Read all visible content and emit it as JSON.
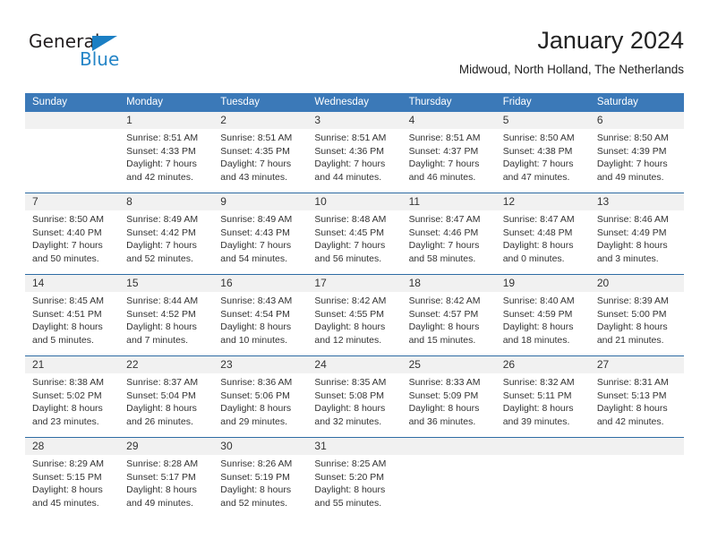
{
  "brand": {
    "name_part1": "General",
    "name_part2": "Blue",
    "triangle_color": "#1b7fc4",
    "blue_color": "#2585c7",
    "dark_color": "#231f20"
  },
  "header": {
    "title": "January 2024",
    "subtitle": "Midwoud, North Holland, The Netherlands"
  },
  "theme": {
    "header_bar_color": "#3b79b8",
    "week_divider_color": "#2e6ca4",
    "date_strip_color": "#f1f1f1",
    "text_color": "#333333"
  },
  "weekdays": [
    "Sunday",
    "Monday",
    "Tuesday",
    "Wednesday",
    "Thursday",
    "Friday",
    "Saturday"
  ],
  "weeks": [
    {
      "days": [
        {
          "date": "",
          "lines": []
        },
        {
          "date": "1",
          "lines": [
            "Sunrise: 8:51 AM",
            "Sunset: 4:33 PM",
            "Daylight: 7 hours",
            "and 42 minutes."
          ]
        },
        {
          "date": "2",
          "lines": [
            "Sunrise: 8:51 AM",
            "Sunset: 4:35 PM",
            "Daylight: 7 hours",
            "and 43 minutes."
          ]
        },
        {
          "date": "3",
          "lines": [
            "Sunrise: 8:51 AM",
            "Sunset: 4:36 PM",
            "Daylight: 7 hours",
            "and 44 minutes."
          ]
        },
        {
          "date": "4",
          "lines": [
            "Sunrise: 8:51 AM",
            "Sunset: 4:37 PM",
            "Daylight: 7 hours",
            "and 46 minutes."
          ]
        },
        {
          "date": "5",
          "lines": [
            "Sunrise: 8:50 AM",
            "Sunset: 4:38 PM",
            "Daylight: 7 hours",
            "and 47 minutes."
          ]
        },
        {
          "date": "6",
          "lines": [
            "Sunrise: 8:50 AM",
            "Sunset: 4:39 PM",
            "Daylight: 7 hours",
            "and 49 minutes."
          ]
        }
      ]
    },
    {
      "days": [
        {
          "date": "7",
          "lines": [
            "Sunrise: 8:50 AM",
            "Sunset: 4:40 PM",
            "Daylight: 7 hours",
            "and 50 minutes."
          ]
        },
        {
          "date": "8",
          "lines": [
            "Sunrise: 8:49 AM",
            "Sunset: 4:42 PM",
            "Daylight: 7 hours",
            "and 52 minutes."
          ]
        },
        {
          "date": "9",
          "lines": [
            "Sunrise: 8:49 AM",
            "Sunset: 4:43 PM",
            "Daylight: 7 hours",
            "and 54 minutes."
          ]
        },
        {
          "date": "10",
          "lines": [
            "Sunrise: 8:48 AM",
            "Sunset: 4:45 PM",
            "Daylight: 7 hours",
            "and 56 minutes."
          ]
        },
        {
          "date": "11",
          "lines": [
            "Sunrise: 8:47 AM",
            "Sunset: 4:46 PM",
            "Daylight: 7 hours",
            "and 58 minutes."
          ]
        },
        {
          "date": "12",
          "lines": [
            "Sunrise: 8:47 AM",
            "Sunset: 4:48 PM",
            "Daylight: 8 hours",
            "and 0 minutes."
          ]
        },
        {
          "date": "13",
          "lines": [
            "Sunrise: 8:46 AM",
            "Sunset: 4:49 PM",
            "Daylight: 8 hours",
            "and 3 minutes."
          ]
        }
      ]
    },
    {
      "days": [
        {
          "date": "14",
          "lines": [
            "Sunrise: 8:45 AM",
            "Sunset: 4:51 PM",
            "Daylight: 8 hours",
            "and 5 minutes."
          ]
        },
        {
          "date": "15",
          "lines": [
            "Sunrise: 8:44 AM",
            "Sunset: 4:52 PM",
            "Daylight: 8 hours",
            "and 7 minutes."
          ]
        },
        {
          "date": "16",
          "lines": [
            "Sunrise: 8:43 AM",
            "Sunset: 4:54 PM",
            "Daylight: 8 hours",
            "and 10 minutes."
          ]
        },
        {
          "date": "17",
          "lines": [
            "Sunrise: 8:42 AM",
            "Sunset: 4:55 PM",
            "Daylight: 8 hours",
            "and 12 minutes."
          ]
        },
        {
          "date": "18",
          "lines": [
            "Sunrise: 8:42 AM",
            "Sunset: 4:57 PM",
            "Daylight: 8 hours",
            "and 15 minutes."
          ]
        },
        {
          "date": "19",
          "lines": [
            "Sunrise: 8:40 AM",
            "Sunset: 4:59 PM",
            "Daylight: 8 hours",
            "and 18 minutes."
          ]
        },
        {
          "date": "20",
          "lines": [
            "Sunrise: 8:39 AM",
            "Sunset: 5:00 PM",
            "Daylight: 8 hours",
            "and 21 minutes."
          ]
        }
      ]
    },
    {
      "days": [
        {
          "date": "21",
          "lines": [
            "Sunrise: 8:38 AM",
            "Sunset: 5:02 PM",
            "Daylight: 8 hours",
            "and 23 minutes."
          ]
        },
        {
          "date": "22",
          "lines": [
            "Sunrise: 8:37 AM",
            "Sunset: 5:04 PM",
            "Daylight: 8 hours",
            "and 26 minutes."
          ]
        },
        {
          "date": "23",
          "lines": [
            "Sunrise: 8:36 AM",
            "Sunset: 5:06 PM",
            "Daylight: 8 hours",
            "and 29 minutes."
          ]
        },
        {
          "date": "24",
          "lines": [
            "Sunrise: 8:35 AM",
            "Sunset: 5:08 PM",
            "Daylight: 8 hours",
            "and 32 minutes."
          ]
        },
        {
          "date": "25",
          "lines": [
            "Sunrise: 8:33 AM",
            "Sunset: 5:09 PM",
            "Daylight: 8 hours",
            "and 36 minutes."
          ]
        },
        {
          "date": "26",
          "lines": [
            "Sunrise: 8:32 AM",
            "Sunset: 5:11 PM",
            "Daylight: 8 hours",
            "and 39 minutes."
          ]
        },
        {
          "date": "27",
          "lines": [
            "Sunrise: 8:31 AM",
            "Sunset: 5:13 PM",
            "Daylight: 8 hours",
            "and 42 minutes."
          ]
        }
      ]
    },
    {
      "days": [
        {
          "date": "28",
          "lines": [
            "Sunrise: 8:29 AM",
            "Sunset: 5:15 PM",
            "Daylight: 8 hours",
            "and 45 minutes."
          ]
        },
        {
          "date": "29",
          "lines": [
            "Sunrise: 8:28 AM",
            "Sunset: 5:17 PM",
            "Daylight: 8 hours",
            "and 49 minutes."
          ]
        },
        {
          "date": "30",
          "lines": [
            "Sunrise: 8:26 AM",
            "Sunset: 5:19 PM",
            "Daylight: 8 hours",
            "and 52 minutes."
          ]
        },
        {
          "date": "31",
          "lines": [
            "Sunrise: 8:25 AM",
            "Sunset: 5:20 PM",
            "Daylight: 8 hours",
            "and 55 minutes."
          ]
        },
        {
          "date": "",
          "lines": []
        },
        {
          "date": "",
          "lines": []
        },
        {
          "date": "",
          "lines": []
        }
      ]
    }
  ]
}
